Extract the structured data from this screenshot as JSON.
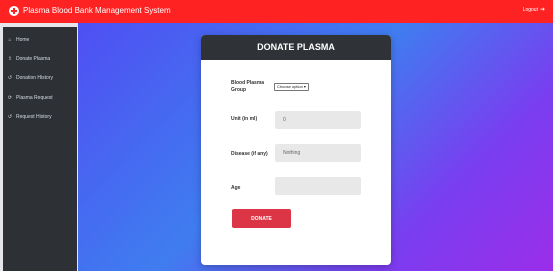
{
  "app": {
    "title": "Plasma Blood Bank Management System",
    "logout_label": "Logout"
  },
  "sidebar": {
    "items": [
      {
        "label": "Home",
        "icon": "home-icon"
      },
      {
        "label": "Donate Plasma",
        "icon": "donate-icon"
      },
      {
        "label": "Donation History",
        "icon": "history-icon"
      },
      {
        "label": "Plasma Request",
        "icon": "sync-icon"
      },
      {
        "label": "Request History",
        "icon": "history-icon"
      }
    ]
  },
  "form": {
    "title": "DONATE PLASMA",
    "blood_group_label": "Blood Plasma Group",
    "blood_group_value": "Choose option",
    "unit_label": "Unit (in ml)",
    "unit_value": "0",
    "disease_label": "Disease (if any)",
    "disease_value": "Nothing",
    "age_label": "Age",
    "age_value": "",
    "submit_label": "DONATE"
  },
  "colors": {
    "topbar": "#ff2222",
    "sidebar": "#2d3136",
    "card_header": "#2f3338",
    "button": "#dc3545"
  }
}
